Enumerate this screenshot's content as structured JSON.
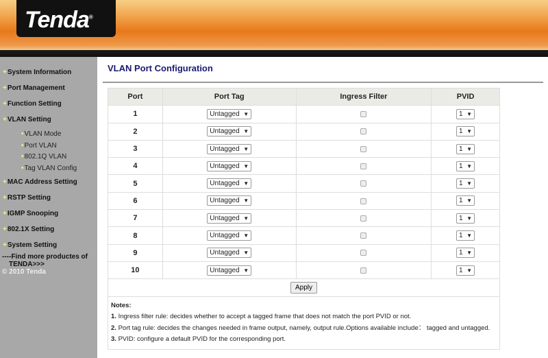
{
  "header": {
    "logo": "Tenda",
    "logo_mark": "®"
  },
  "sidebar": {
    "items": [
      {
        "label": "System Information",
        "level": 1
      },
      {
        "label": "Port Management",
        "level": 1
      },
      {
        "label": "Function Setting",
        "level": 1
      },
      {
        "label": "VLAN Setting",
        "level": 1
      },
      {
        "label": "VLAN Mode",
        "level": 2
      },
      {
        "label": "Port VLAN",
        "level": 2
      },
      {
        "label": "802.1Q VLAN",
        "level": 2
      },
      {
        "label": "Tag VLAN Config",
        "level": 2
      },
      {
        "label": "MAC Address Setting",
        "level": 1
      },
      {
        "label": "RSTP Setting",
        "level": 1
      },
      {
        "label": "IGMP Snooping",
        "level": 1
      },
      {
        "label": "802.1X Setting",
        "level": 1
      },
      {
        "label": "System Setting",
        "level": 1
      }
    ],
    "find_more": "----Find more productes of",
    "find_more2": "TENDA>>>",
    "copyright": "© 2010 Tenda"
  },
  "page": {
    "title": "VLAN Port Configuration"
  },
  "table": {
    "headers": [
      "Port",
      "Port Tag",
      "Ingress Filter",
      "PVID"
    ],
    "rows": [
      {
        "port": "1",
        "tag": "Untagged",
        "ingress": false,
        "pvid": "1"
      },
      {
        "port": "2",
        "tag": "Untagged",
        "ingress": false,
        "pvid": "1"
      },
      {
        "port": "3",
        "tag": "Untagged",
        "ingress": false,
        "pvid": "1"
      },
      {
        "port": "4",
        "tag": "Untagged",
        "ingress": false,
        "pvid": "1"
      },
      {
        "port": "5",
        "tag": "Untagged",
        "ingress": false,
        "pvid": "1"
      },
      {
        "port": "6",
        "tag": "Untagged",
        "ingress": false,
        "pvid": "1"
      },
      {
        "port": "7",
        "tag": "Untagged",
        "ingress": false,
        "pvid": "1"
      },
      {
        "port": "8",
        "tag": "Untagged",
        "ingress": false,
        "pvid": "1"
      },
      {
        "port": "9",
        "tag": "Untagged",
        "ingress": false,
        "pvid": "1"
      },
      {
        "port": "10",
        "tag": "Untagged",
        "ingress": false,
        "pvid": "1"
      }
    ]
  },
  "apply_label": "Apply",
  "notes": {
    "title": "Notes:",
    "items": [
      {
        "num": "1.",
        "text": " Ingress filter rule: decides whether to accept a tagged frame that does not match the port PVID or not."
      },
      {
        "num": "2.",
        "text": " Port tag rule: decides the changes needed in frame output, namely, output rule.Options available include： tagged and untagged."
      },
      {
        "num": "3.",
        "text": " PVID: configure a default PVID for the corresponding port."
      }
    ]
  }
}
